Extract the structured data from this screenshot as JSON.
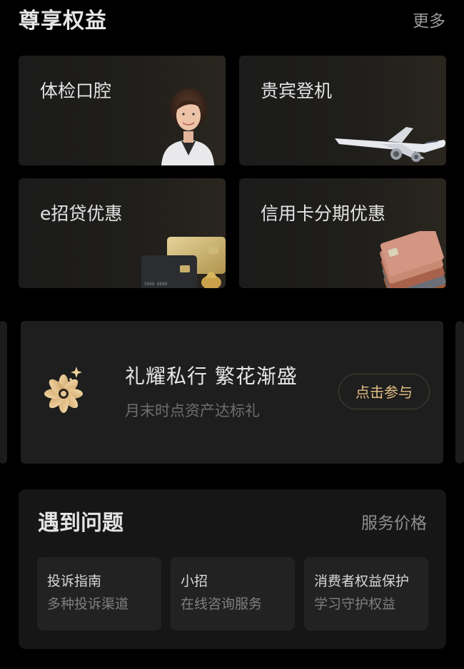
{
  "privileges": {
    "title": "尊享权益",
    "more_label": "更多",
    "cards": [
      {
        "label": "体检口腔",
        "image": "doctor-portrait"
      },
      {
        "label": "贵宾登机",
        "image": "airplane"
      },
      {
        "label": "e招贷优惠",
        "image": "bank-cards-gold"
      },
      {
        "label": "信用卡分期优惠",
        "image": "credit-cards-stack"
      }
    ]
  },
  "promo": {
    "icon": "flower-sparkle-icon",
    "title": "礼耀私行 繁花渐盛",
    "subtitle": "月末时点资产达标礼",
    "button_label": "点击参与",
    "accent_color": "#e2bc82"
  },
  "help": {
    "title": "遇到问题",
    "link_label": "服务价格",
    "items": [
      {
        "title": "投诉指南",
        "desc": "多种投诉渠道"
      },
      {
        "title": "小招",
        "desc": "在线咨询服务"
      },
      {
        "title": "消费者权益保护",
        "desc": "学习守护权益"
      }
    ]
  }
}
